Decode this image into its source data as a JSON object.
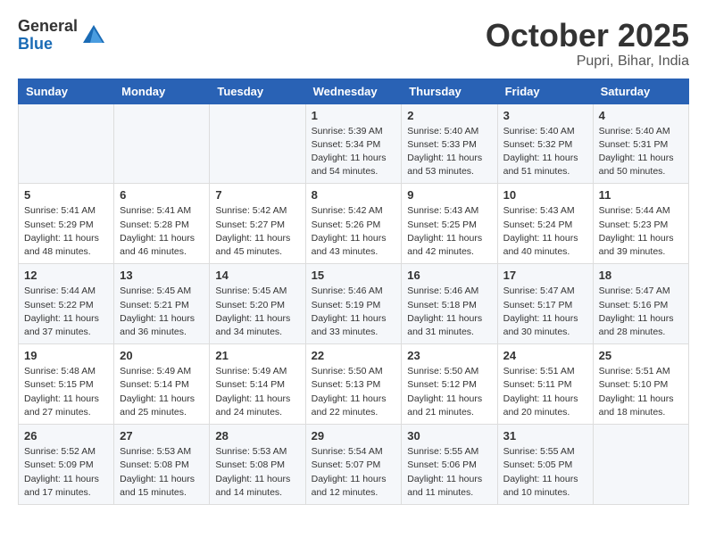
{
  "header": {
    "logo_general": "General",
    "logo_blue": "Blue",
    "month_title": "October 2025",
    "location": "Pupri, Bihar, India"
  },
  "weekdays": [
    "Sunday",
    "Monday",
    "Tuesday",
    "Wednesday",
    "Thursday",
    "Friday",
    "Saturday"
  ],
  "weeks": [
    [
      {
        "day": "",
        "info": ""
      },
      {
        "day": "",
        "info": ""
      },
      {
        "day": "",
        "info": ""
      },
      {
        "day": "1",
        "info": "Sunrise: 5:39 AM\nSunset: 5:34 PM\nDaylight: 11 hours\nand 54 minutes."
      },
      {
        "day": "2",
        "info": "Sunrise: 5:40 AM\nSunset: 5:33 PM\nDaylight: 11 hours\nand 53 minutes."
      },
      {
        "day": "3",
        "info": "Sunrise: 5:40 AM\nSunset: 5:32 PM\nDaylight: 11 hours\nand 51 minutes."
      },
      {
        "day": "4",
        "info": "Sunrise: 5:40 AM\nSunset: 5:31 PM\nDaylight: 11 hours\nand 50 minutes."
      }
    ],
    [
      {
        "day": "5",
        "info": "Sunrise: 5:41 AM\nSunset: 5:29 PM\nDaylight: 11 hours\nand 48 minutes."
      },
      {
        "day": "6",
        "info": "Sunrise: 5:41 AM\nSunset: 5:28 PM\nDaylight: 11 hours\nand 46 minutes."
      },
      {
        "day": "7",
        "info": "Sunrise: 5:42 AM\nSunset: 5:27 PM\nDaylight: 11 hours\nand 45 minutes."
      },
      {
        "day": "8",
        "info": "Sunrise: 5:42 AM\nSunset: 5:26 PM\nDaylight: 11 hours\nand 43 minutes."
      },
      {
        "day": "9",
        "info": "Sunrise: 5:43 AM\nSunset: 5:25 PM\nDaylight: 11 hours\nand 42 minutes."
      },
      {
        "day": "10",
        "info": "Sunrise: 5:43 AM\nSunset: 5:24 PM\nDaylight: 11 hours\nand 40 minutes."
      },
      {
        "day": "11",
        "info": "Sunrise: 5:44 AM\nSunset: 5:23 PM\nDaylight: 11 hours\nand 39 minutes."
      }
    ],
    [
      {
        "day": "12",
        "info": "Sunrise: 5:44 AM\nSunset: 5:22 PM\nDaylight: 11 hours\nand 37 minutes."
      },
      {
        "day": "13",
        "info": "Sunrise: 5:45 AM\nSunset: 5:21 PM\nDaylight: 11 hours\nand 36 minutes."
      },
      {
        "day": "14",
        "info": "Sunrise: 5:45 AM\nSunset: 5:20 PM\nDaylight: 11 hours\nand 34 minutes."
      },
      {
        "day": "15",
        "info": "Sunrise: 5:46 AM\nSunset: 5:19 PM\nDaylight: 11 hours\nand 33 minutes."
      },
      {
        "day": "16",
        "info": "Sunrise: 5:46 AM\nSunset: 5:18 PM\nDaylight: 11 hours\nand 31 minutes."
      },
      {
        "day": "17",
        "info": "Sunrise: 5:47 AM\nSunset: 5:17 PM\nDaylight: 11 hours\nand 30 minutes."
      },
      {
        "day": "18",
        "info": "Sunrise: 5:47 AM\nSunset: 5:16 PM\nDaylight: 11 hours\nand 28 minutes."
      }
    ],
    [
      {
        "day": "19",
        "info": "Sunrise: 5:48 AM\nSunset: 5:15 PM\nDaylight: 11 hours\nand 27 minutes."
      },
      {
        "day": "20",
        "info": "Sunrise: 5:49 AM\nSunset: 5:14 PM\nDaylight: 11 hours\nand 25 minutes."
      },
      {
        "day": "21",
        "info": "Sunrise: 5:49 AM\nSunset: 5:14 PM\nDaylight: 11 hours\nand 24 minutes."
      },
      {
        "day": "22",
        "info": "Sunrise: 5:50 AM\nSunset: 5:13 PM\nDaylight: 11 hours\nand 22 minutes."
      },
      {
        "day": "23",
        "info": "Sunrise: 5:50 AM\nSunset: 5:12 PM\nDaylight: 11 hours\nand 21 minutes."
      },
      {
        "day": "24",
        "info": "Sunrise: 5:51 AM\nSunset: 5:11 PM\nDaylight: 11 hours\nand 20 minutes."
      },
      {
        "day": "25",
        "info": "Sunrise: 5:51 AM\nSunset: 5:10 PM\nDaylight: 11 hours\nand 18 minutes."
      }
    ],
    [
      {
        "day": "26",
        "info": "Sunrise: 5:52 AM\nSunset: 5:09 PM\nDaylight: 11 hours\nand 17 minutes."
      },
      {
        "day": "27",
        "info": "Sunrise: 5:53 AM\nSunset: 5:08 PM\nDaylight: 11 hours\nand 15 minutes."
      },
      {
        "day": "28",
        "info": "Sunrise: 5:53 AM\nSunset: 5:08 PM\nDaylight: 11 hours\nand 14 minutes."
      },
      {
        "day": "29",
        "info": "Sunrise: 5:54 AM\nSunset: 5:07 PM\nDaylight: 11 hours\nand 12 minutes."
      },
      {
        "day": "30",
        "info": "Sunrise: 5:55 AM\nSunset: 5:06 PM\nDaylight: 11 hours\nand 11 minutes."
      },
      {
        "day": "31",
        "info": "Sunrise: 5:55 AM\nSunset: 5:05 PM\nDaylight: 11 hours\nand 10 minutes."
      },
      {
        "day": "",
        "info": ""
      }
    ]
  ]
}
